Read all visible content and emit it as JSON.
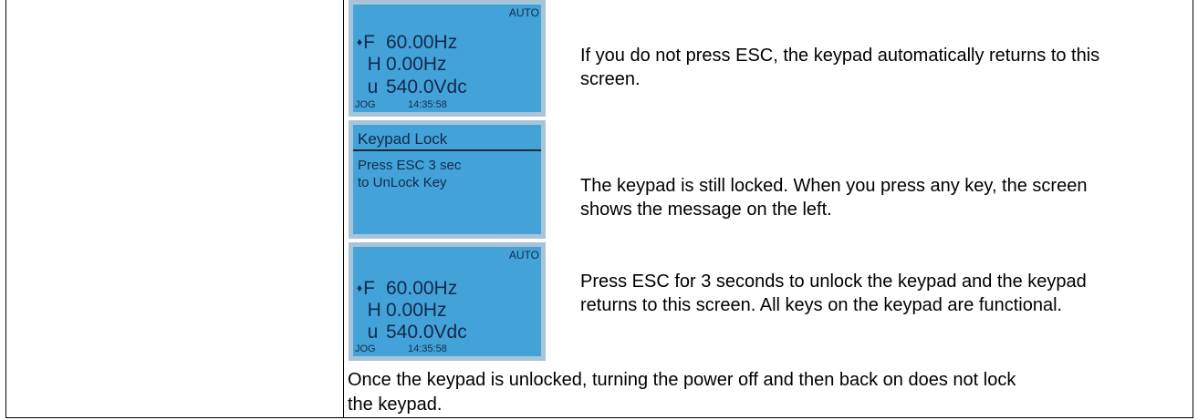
{
  "lcd_top": {
    "mode": "AUTO",
    "line1_symbol": "F",
    "line1_value": "60.00Hz",
    "line2_symbol": "H",
    "line2_value": "0.00Hz",
    "line3_symbol": "u",
    "line3_value": "540.0Vdc",
    "footer_left": "JOG",
    "footer_time": "14:35:58"
  },
  "desc_top": "If you do not press ESC, the keypad automatically returns to this screen.",
  "lcd_lock": {
    "title": "Keypad Lock",
    "line1": "Press ESC 3 sec",
    "line2": "to UnLock Key"
  },
  "desc_middle": "The keypad is still locked. When you press any key, the screen shows the message on the left.",
  "lcd_bottom": {
    "mode": "AUTO",
    "line1_symbol": "F",
    "line1_value": "60.00Hz",
    "line2_symbol": "H",
    "line2_value": "0.00Hz",
    "line3_symbol": "u",
    "line3_value": "540.0Vdc",
    "footer_left": "JOG",
    "footer_time": "14:35:58"
  },
  "desc_bottom": "Press ESC for 3 seconds to unlock the keypad and the keypad returns to this screen. All keys on the keypad are functional.",
  "note": "Once the keypad is unlocked, turning the power off and then back on does not lock the keypad."
}
